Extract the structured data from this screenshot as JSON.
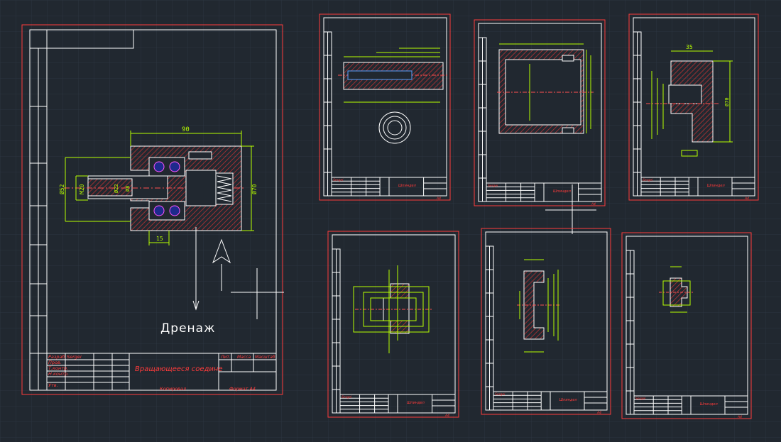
{
  "main_sheet": {
    "title_block": {
      "designation": "Вращающееся соедине",
      "roles": [
        "Разраб.",
        "Пров.",
        "Т.контр.",
        "Н.контр.",
        "Утв."
      ],
      "developer": "Sergei",
      "column_heads": [
        "Лит.",
        "Масса",
        "Масштаб"
      ],
      "copied": "Копировал",
      "format": "Формат А4"
    },
    "side_stamp": [
      "Перв. примен.",
      "Справ. №",
      "Подп. и дата",
      "Инв. № дубл.",
      "Взам. инв. №",
      "Подп. и дата",
      "Инв. № подл."
    ],
    "dimensions": {
      "length": "90",
      "d52": "Ø52",
      "m20": "M20",
      "d22": "Ø22",
      "d8": "Ø8",
      "d70": "Ø70",
      "w15": "15"
    },
    "drain_label": "Дренаж"
  },
  "small_sheets": {
    "developer": "Sergei",
    "title": "Шпиндел",
    "format": "А4"
  },
  "detail_dims": {
    "sheet_c_35": "35",
    "sheet_c_d70": "Ø70"
  },
  "colors": {
    "background": "#212830",
    "frame": "#ff3b3b",
    "drawing": "#ffffff",
    "dimension": "#b8ff00",
    "hatch": "#a03030"
  }
}
